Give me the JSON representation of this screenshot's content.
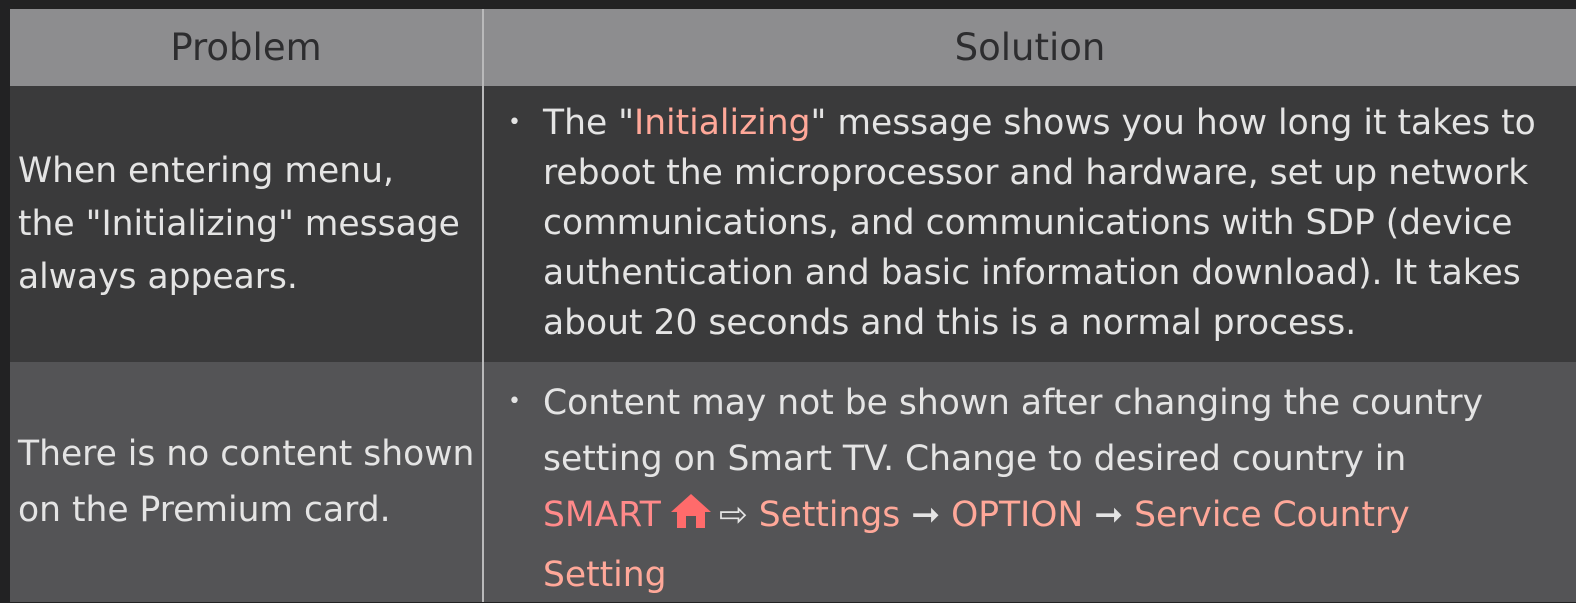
{
  "table": {
    "header": {
      "problem": "Problem",
      "solution": "Solution"
    },
    "rows": [
      {
        "problem_lines": [
          "When entering menu,",
          "the \"Initializing\" message",
          "always appears."
        ],
        "bullet": "•",
        "solution": {
          "line1_pre": "The \"",
          "line1_highlight": "Initializing",
          "line1_post": "\" message shows you how long it takes to",
          "line2": "reboot the microprocessor and hardware, set up network",
          "line3": "communications, and communications with SDP (device",
          "line4": "authentication and basic information download). It takes",
          "line5": "about 20 seconds and this is a normal process."
        }
      },
      {
        "problem_lines": [
          "There is no content shown",
          "on the Premium card."
        ],
        "bullet": "•",
        "solution": {
          "line1": "Content may not be shown after changing the country",
          "line2": "setting on Smart TV. Change to desired country in",
          "smart": "SMART",
          "home_icon": "home-icon",
          "arrow_open": "⇨",
          "settings": "Settings",
          "arrow1": "➞",
          "option": "OPTION",
          "arrow2": "➞",
          "service_country": "Service Country",
          "setting": "Setting"
        }
      }
    ]
  },
  "colors": {
    "header_bg": "#8d8d8f",
    "row1_bg": "#3a3a3b",
    "row2_bg": "#545456",
    "highlight": "#ffa899",
    "smart": "#ff8a8a"
  }
}
